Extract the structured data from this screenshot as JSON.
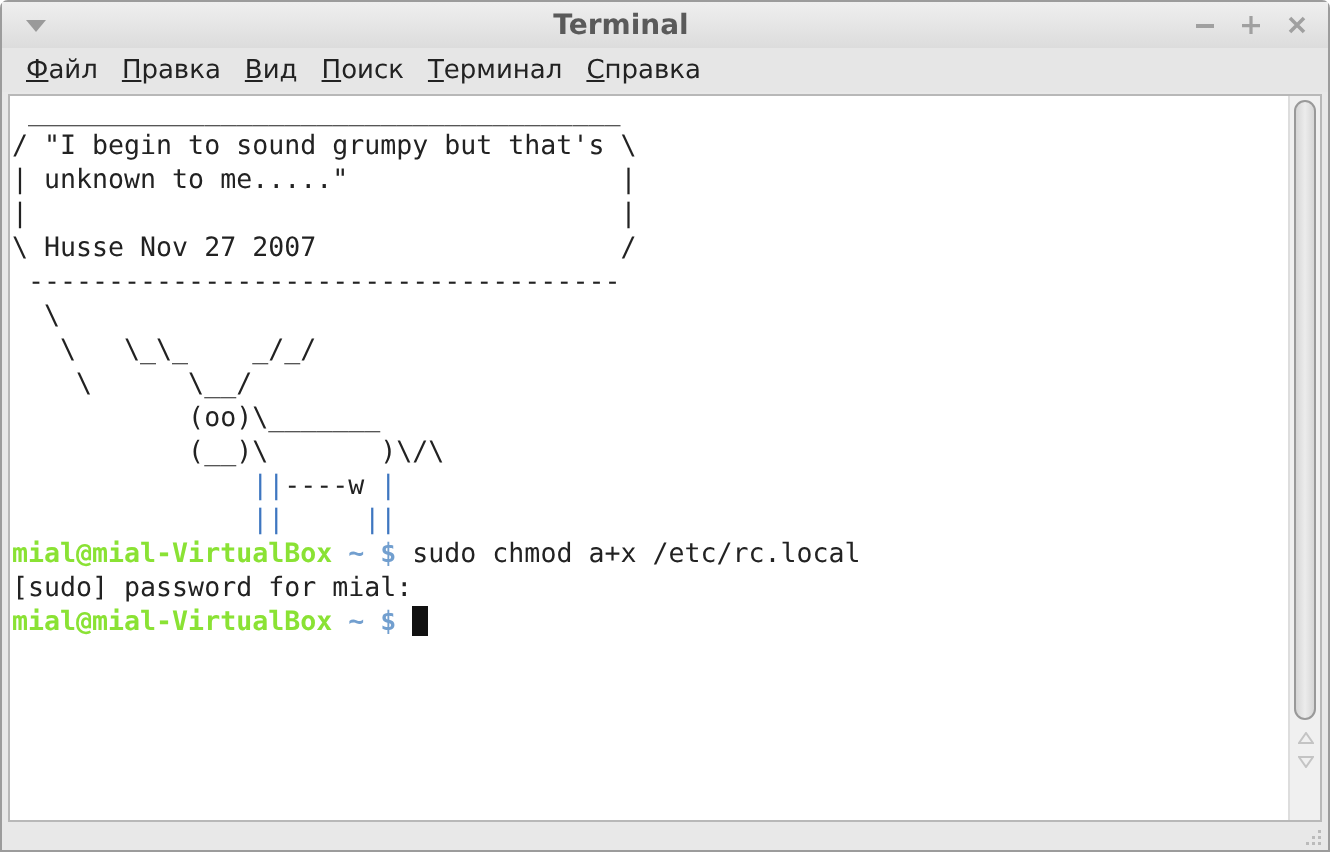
{
  "window": {
    "title": "Terminal"
  },
  "menu": [
    {
      "label": "Файл"
    },
    {
      "label": "Правка"
    },
    {
      "label": "Вид"
    },
    {
      "label": "Поиск"
    },
    {
      "label": "Терминал"
    },
    {
      "label": "Справка"
    }
  ],
  "terminal": {
    "lines": [
      [
        {
          "kind": "plain",
          "text": " _____________________________________"
        }
      ],
      [
        {
          "kind": "plain",
          "text": "/ \"I begin to sound grumpy but that's \\"
        }
      ],
      [
        {
          "kind": "plain",
          "text": "| unknown to me.....\"                 |"
        }
      ],
      [
        {
          "kind": "plain",
          "text": "|                                     |"
        }
      ],
      [
        {
          "kind": "plain",
          "text": "\\ Husse Nov 27 2007                   /"
        }
      ],
      [
        {
          "kind": "plain",
          "text": " -------------------------------------"
        }
      ],
      [
        {
          "kind": "plain",
          "text": "  \\"
        }
      ],
      [
        {
          "kind": "plain",
          "text": "   \\   \\_\\_    _/_/"
        }
      ],
      [
        {
          "kind": "plain",
          "text": "    \\      \\__/"
        }
      ],
      [
        {
          "kind": "plain",
          "text": "           (oo)\\_______"
        }
      ],
      [
        {
          "kind": "plain",
          "text": "           (__)\\       )\\/\\"
        }
      ],
      [
        {
          "kind": "art",
          "text": "               ||"
        },
        {
          "kind": "plain",
          "text": "----w "
        },
        {
          "kind": "art",
          "text": "|"
        }
      ],
      [
        {
          "kind": "art",
          "text": "               ||"
        },
        {
          "kind": "art",
          "text": "     ||"
        }
      ],
      [
        {
          "kind": "user",
          "text": "mial@mial-VirtualBox"
        },
        {
          "kind": "path",
          "text": " ~ $"
        },
        {
          "kind": "plain",
          "text": " sudo chmod a+x /etc/rc.local"
        }
      ],
      [
        {
          "kind": "plain",
          "text": "[sudo] password for mial:"
        }
      ],
      [
        {
          "kind": "user",
          "text": "mial@mial-VirtualBox"
        },
        {
          "kind": "path",
          "text": " ~ $ "
        },
        {
          "kind": "cursor"
        }
      ]
    ]
  }
}
